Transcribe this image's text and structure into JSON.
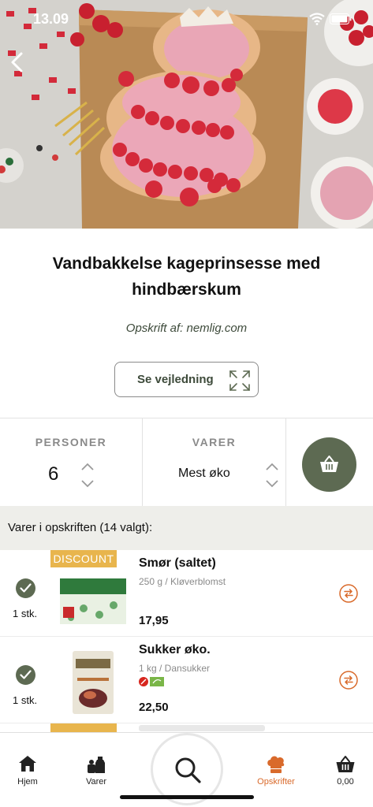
{
  "status_bar": {
    "time": "13.09"
  },
  "recipe": {
    "title": "Vandbakkelse kageprinsesse med hindbærskum",
    "byline": "Opskrift af: nemlig.com",
    "guide_button": "Se vejledning"
  },
  "controls": {
    "persons_label": "PERSONER",
    "persons_value": "6",
    "items_label": "VARER",
    "items_value": "Mest øko"
  },
  "section": {
    "title": "Varer i opskriften (14 valgt):"
  },
  "products": [
    {
      "discount": "DISCOUNT",
      "name": "Smør (saltet)",
      "subtitle": "250 g / Kløverblomst",
      "price": "17,95",
      "quantity": "1 stk."
    },
    {
      "name": "Sukker øko.",
      "subtitle": "1 kg / Dansukker",
      "price": "22,50",
      "quantity": "1 stk."
    }
  ],
  "tabbar": {
    "home": "Hjem",
    "items": "Varer",
    "recipes": "Opskrifter",
    "basket": "0,00"
  },
  "colors": {
    "accent_green": "#5d6a52",
    "accent_orange": "#d96a2b",
    "discount_yellow": "#e8b54d"
  },
  "icons": [
    "back-icon",
    "wifi-icon",
    "battery-icon",
    "expand-icon",
    "chevron-up-icon",
    "chevron-down-icon",
    "basket-icon",
    "check-icon",
    "swap-icon",
    "home-icon",
    "groceries-icon",
    "search-icon",
    "chef-hat-icon"
  ]
}
